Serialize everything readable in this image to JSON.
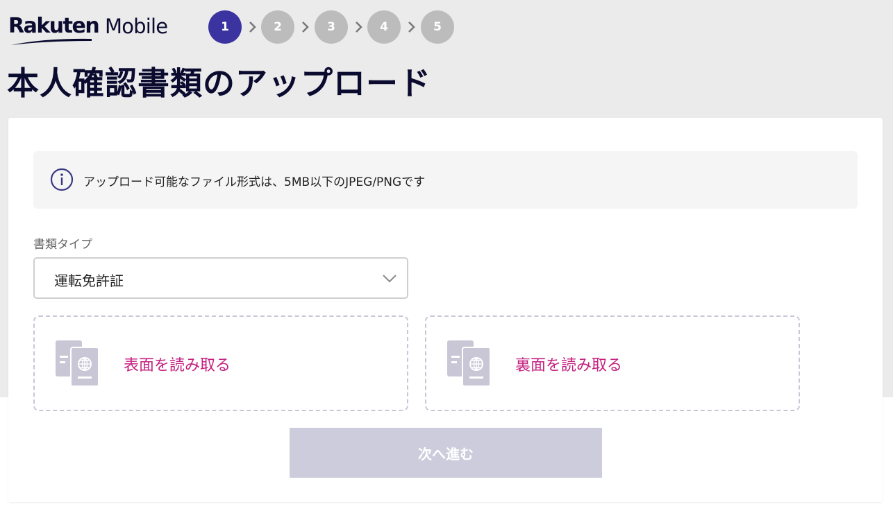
{
  "header": {
    "logo_primary": "Rakuten",
    "logo_secondary": "Mobile",
    "steps": [
      {
        "label": "1",
        "active": true
      },
      {
        "label": "2",
        "active": false
      },
      {
        "label": "3",
        "active": false
      },
      {
        "label": "4",
        "active": false
      },
      {
        "label": "5",
        "active": false
      }
    ]
  },
  "page_title": "本人確認書類のアップロード",
  "notice": {
    "icon": "info-icon",
    "text": "アップロード可能なファイル形式は、5MB以下のJPEG/PNGです"
  },
  "document_type": {
    "label": "書類タイプ",
    "selected": "運転免許証"
  },
  "uploads": {
    "front_label": "表面を読み取る",
    "back_label": "裏面を読み取る",
    "icon": "id-document-icon"
  },
  "next_button": {
    "label": "次へ進む",
    "enabled": false
  },
  "colors": {
    "brand_navy": "#0b0b30",
    "active_step": "#3a33a0",
    "inactive_step": "#bcbcbc",
    "upload_text": "#c4207f",
    "disabled_button": "#ccccdc"
  }
}
